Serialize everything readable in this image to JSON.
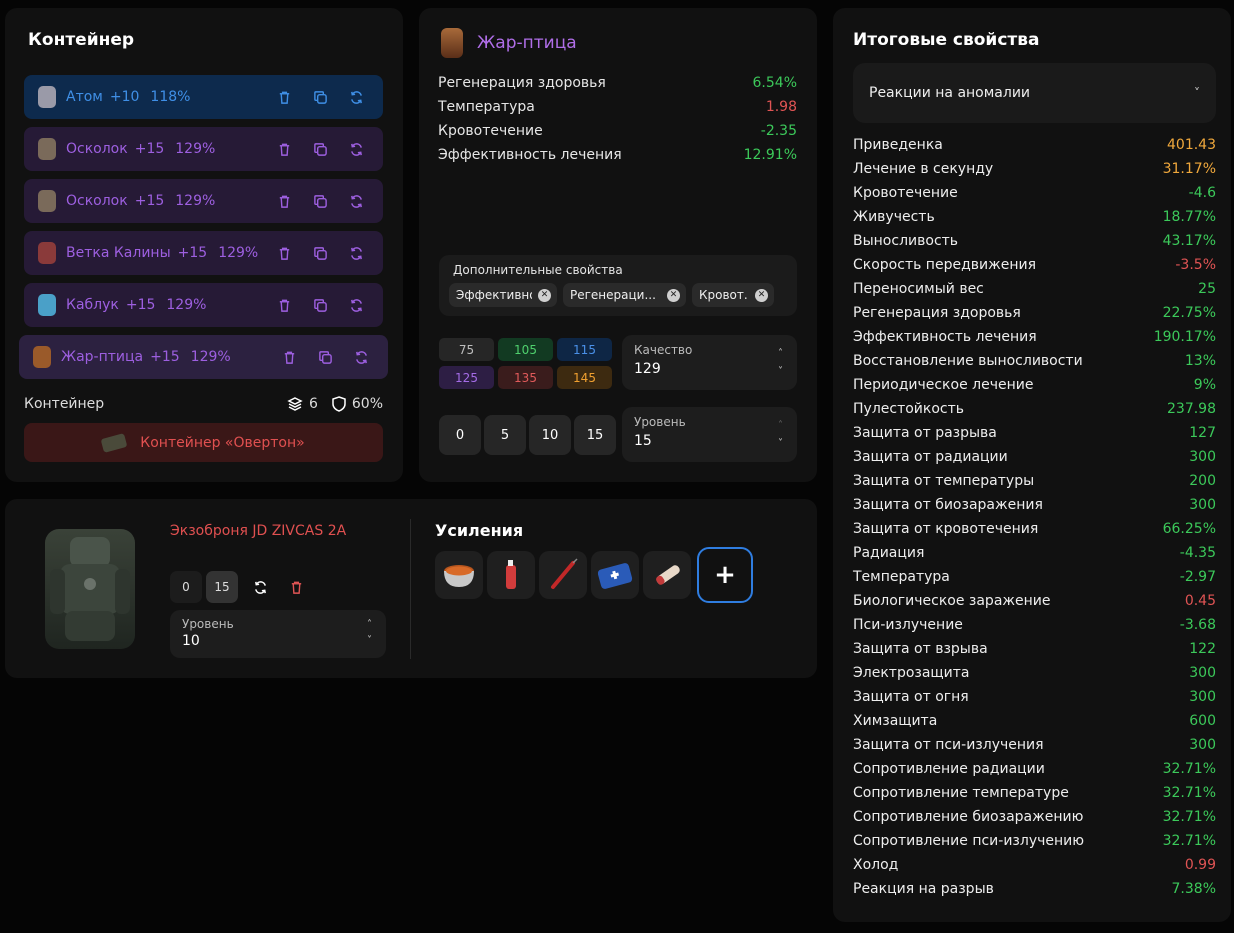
{
  "colors": {
    "green": "#3cc95a",
    "red": "#e05454",
    "orange": "#f0a83c",
    "blue_accent": "#3f8fe6",
    "purple_accent": "#9d5fe0"
  },
  "container": {
    "title": "Контейнер",
    "artifacts": [
      {
        "name": "Атом",
        "level": "+10",
        "percent": "118%",
        "tone": "blue",
        "icon": "atom-icon"
      },
      {
        "name": "Осколок",
        "level": "+15",
        "percent": "129%",
        "tone": "purple",
        "icon": "shard-icon"
      },
      {
        "name": "Осколок",
        "level": "+15",
        "percent": "129%",
        "tone": "purple",
        "icon": "shard-icon"
      },
      {
        "name": "Ветка Калины",
        "level": "+15",
        "percent": "129%",
        "tone": "purple",
        "icon": "branch-icon"
      },
      {
        "name": "Каблук",
        "level": "+15",
        "percent": "129%",
        "tone": "purple",
        "icon": "heel-icon"
      },
      {
        "name": "Жар-птица",
        "level": "+15",
        "percent": "129%",
        "tone": "selected",
        "icon": "firebird-icon"
      }
    ],
    "footer_label": "Контейнер",
    "slots": "6",
    "protection": "60%",
    "container_button": "Контейнер «Овертон»"
  },
  "artifact": {
    "name": "Жар-птица",
    "properties": [
      {
        "label": "Регенерация здоровья",
        "value": "6.54%",
        "color": "#3cc95a"
      },
      {
        "label": "Температура",
        "value": "1.98",
        "color": "#e05454"
      },
      {
        "label": "Кровотечение",
        "value": "-2.35",
        "color": "#3cc95a"
      },
      {
        "label": "Эффективность лечения",
        "value": "12.91%",
        "color": "#3cc95a"
      }
    ],
    "extra_title": "Дополнительные свойства",
    "extra_chips": [
      "Эффективнос...",
      "Регенераци...",
      "Кровот..."
    ],
    "quality_cells": [
      {
        "value": "75",
        "bg": "#262626",
        "fg": "#bdbdbd"
      },
      {
        "value": "105",
        "bg": "#123a22",
        "fg": "#4fd06d"
      },
      {
        "value": "115",
        "bg": "#0e2645",
        "fg": "#4a90e8"
      },
      {
        "value": "125",
        "bg": "#2d1e44",
        "fg": "#a46ce6"
      },
      {
        "value": "135",
        "bg": "#3a1c1c",
        "fg": "#e05a5a"
      },
      {
        "value": "145",
        "bg": "#3d2a10",
        "fg": "#f0a030"
      }
    ],
    "quality_label": "Качество",
    "quality_value": "129",
    "level_buttons": [
      "0",
      "5",
      "10",
      "15"
    ],
    "level_label": "Уровень",
    "level_value": "15"
  },
  "armor": {
    "name": "Экзоброня JD ZIVCAS 2A",
    "levels": [
      "0",
      "15"
    ],
    "level_label": "Уровень",
    "level_value": "10",
    "boosts_title": "Усиления",
    "boosts": [
      "stew-pot-icon",
      "spray-can-icon",
      "syringe-icon",
      "medkit-icon",
      "bandage-icon"
    ],
    "add_label": "+"
  },
  "summary": {
    "title": "Итоговые свойства",
    "filter": "Реакции на аномалии",
    "rows": [
      {
        "label": "Приведенка",
        "value": "401.43",
        "color": "#f0a83c"
      },
      {
        "label": "Лечение в секунду",
        "value": "31.17%",
        "color": "#f0a83c"
      },
      {
        "label": "Кровотечение",
        "value": "-4.6",
        "color": "#3cc95a"
      },
      {
        "label": "Живучесть",
        "value": "18.77%",
        "color": "#3cc95a"
      },
      {
        "label": "Выносливость",
        "value": "43.17%",
        "color": "#3cc95a"
      },
      {
        "label": "Скорость передвижения",
        "value": "-3.5%",
        "color": "#e05454"
      },
      {
        "label": "Переносимый вес",
        "value": "25",
        "color": "#3cc95a"
      },
      {
        "label": "Регенерация здоровья",
        "value": "22.75%",
        "color": "#3cc95a"
      },
      {
        "label": "Эффективность лечения",
        "value": "190.17%",
        "color": "#3cc95a"
      },
      {
        "label": "Восстановление выносливости",
        "value": "13%",
        "color": "#3cc95a"
      },
      {
        "label": "Периодическое лечение",
        "value": "9%",
        "color": "#3cc95a"
      },
      {
        "label": "Пулестойкость",
        "value": "237.98",
        "color": "#3cc95a"
      },
      {
        "label": "Защита от разрыва",
        "value": "127",
        "color": "#3cc95a"
      },
      {
        "label": "Защита от радиации",
        "value": "300",
        "color": "#3cc95a"
      },
      {
        "label": "Защита от температуры",
        "value": "200",
        "color": "#3cc95a"
      },
      {
        "label": "Защита от биозаражения",
        "value": "300",
        "color": "#3cc95a"
      },
      {
        "label": "Защита от кровотечения",
        "value": "66.25%",
        "color": "#3cc95a"
      },
      {
        "label": "Радиация",
        "value": "-4.35",
        "color": "#3cc95a"
      },
      {
        "label": "Температура",
        "value": "-2.97",
        "color": "#3cc95a"
      },
      {
        "label": "Биологическое заражение",
        "value": "0.45",
        "color": "#e05454"
      },
      {
        "label": "Пси-излучение",
        "value": "-3.68",
        "color": "#3cc95a"
      },
      {
        "label": "Защита от взрыва",
        "value": "122",
        "color": "#3cc95a"
      },
      {
        "label": "Электрозащита",
        "value": "300",
        "color": "#3cc95a"
      },
      {
        "label": "Защита от огня",
        "value": "300",
        "color": "#3cc95a"
      },
      {
        "label": "Химзащита",
        "value": "600",
        "color": "#3cc95a"
      },
      {
        "label": "Защита от пси-излучения",
        "value": "300",
        "color": "#3cc95a"
      },
      {
        "label": "Сопротивление радиации",
        "value": "32.71%",
        "color": "#3cc95a"
      },
      {
        "label": "Сопротивление температуре",
        "value": "32.71%",
        "color": "#3cc95a"
      },
      {
        "label": "Сопротивление биозаражению",
        "value": "32.71%",
        "color": "#3cc95a"
      },
      {
        "label": "Сопротивление пси-излучению",
        "value": "32.71%",
        "color": "#3cc95a"
      },
      {
        "label": "Холод",
        "value": "0.99",
        "color": "#e05454"
      },
      {
        "label": "Реакция на разрыв",
        "value": "7.38%",
        "color": "#3cc95a"
      }
    ]
  }
}
